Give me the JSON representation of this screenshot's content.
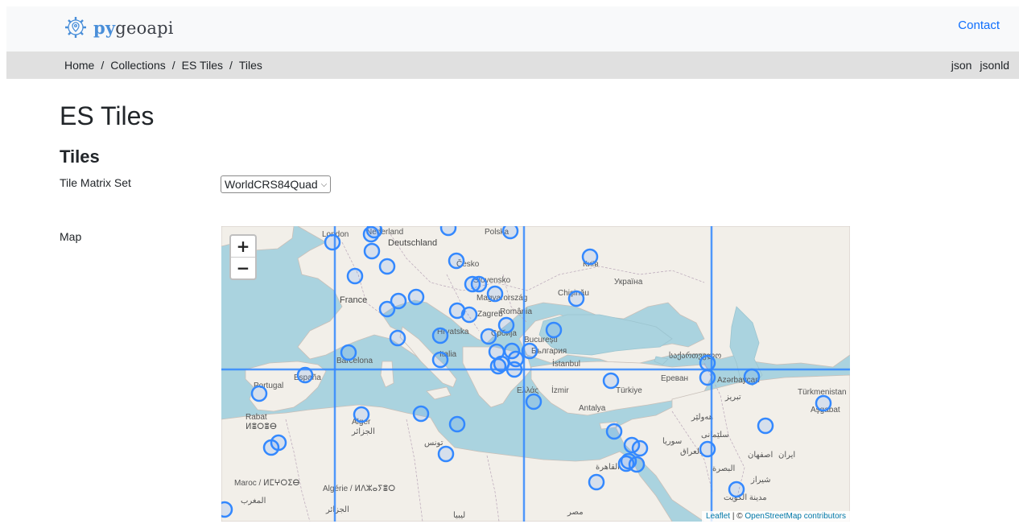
{
  "brand": {
    "logo_icon": "gear-pin-icon",
    "part1": "py",
    "part2": "geoapi"
  },
  "nav": {
    "contact": "Contact"
  },
  "breadcrumb": [
    {
      "label": "Home"
    },
    {
      "label": "Collections"
    },
    {
      "label": "ES Tiles"
    },
    {
      "label": "Tiles"
    }
  ],
  "breadcrumb_sep": "/",
  "formats": [
    "json",
    "jsonld"
  ],
  "page": {
    "title": "ES Tiles",
    "subtitle": "Tiles"
  },
  "form": {
    "tms_label": "Tile Matrix Set",
    "tms_value": "WorldCRS84Quad",
    "map_label": "Map"
  },
  "map": {
    "zoom_in": "+",
    "zoom_out": "−",
    "attribution_link1": "Leaflet",
    "attribution_sep": " | © ",
    "attribution_link2": "OpenStreetMap contributors",
    "marker_color": "#3388ff",
    "grid_color": "#3388ff",
    "place_labels": [
      "London",
      "Nederland",
      "Deutschland",
      "Polska",
      "Česko",
      "Slovensko",
      "Magyarország",
      "Київ",
      "Україна",
      "Chişinău",
      "France",
      "România",
      "Zagreb",
      "Hrvatska",
      "Србија",
      "București",
      "България",
      "Barcelona",
      "Italia",
      "İstanbul",
      "Portugal",
      "España",
      "Ελλάς",
      "İzmir",
      "Türkiye",
      "Antalya",
      "Azərbaycan",
      "Türkmenistan",
      "Aşgabat",
      "Rabat",
      "ⵍⴻⵔⴻⴱ",
      "Alger",
      "الجزائر",
      "تونس",
      "سوريا",
      "العراق",
      "ایران",
      "اصفهان",
      "شيراز",
      "البصرة",
      "مدينة الكويت",
      "Maroc / ⵍⵎⵖⵔⵉⴱ",
      "المغرب",
      "Algérie / ⵍⴷⵣⴰⵢⴻⵔ",
      "الجزائر",
      "ليبيا",
      "مصر",
      "القاهرة",
      "საქართველო",
      "Ереван",
      "تبریز",
      "هەولێر",
      "سلێمانی"
    ]
  }
}
